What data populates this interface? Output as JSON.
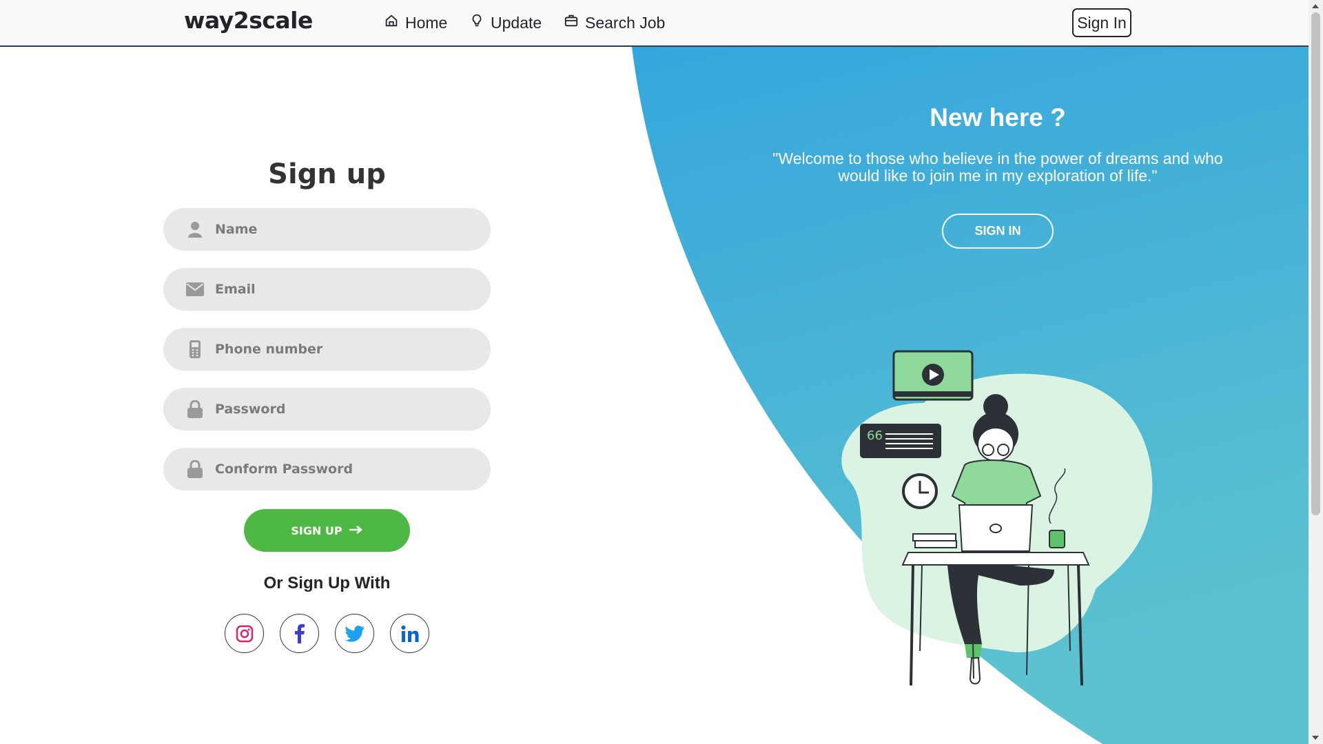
{
  "navbar": {
    "brand": "way2scale",
    "items": [
      {
        "label": "Home",
        "icon": "home-icon"
      },
      {
        "label": "Update",
        "icon": "lightbulb-icon"
      },
      {
        "label": "Search Job",
        "icon": "briefcase-icon"
      }
    ],
    "signin_label": "Sign In"
  },
  "panel": {
    "title": "New here ?",
    "quote": "\"Welcome to those who believe in the power of dreams and who would like to join me in my exploration of life.\"",
    "signin_button": "SIGN IN"
  },
  "form": {
    "title": "Sign up",
    "fields": [
      {
        "placeholder": "Name",
        "icon": "user-icon"
      },
      {
        "placeholder": "Email",
        "icon": "envelope-icon"
      },
      {
        "placeholder": "Phone number",
        "icon": "mobile-phone-icon"
      },
      {
        "placeholder": "Password",
        "icon": "lock-icon"
      },
      {
        "placeholder": "Conform Password",
        "icon": "lock-icon"
      }
    ],
    "submit_label": "SIGN UP",
    "social_text": "Or Sign Up With",
    "social": [
      "instagram-icon",
      "facebook-icon",
      "twitter-icon",
      "linkedin-icon"
    ]
  },
  "colors": {
    "accent_green": "#4db843",
    "panel_blue_top": "#36a7dc",
    "panel_blue_bottom": "#5cc0d0"
  }
}
